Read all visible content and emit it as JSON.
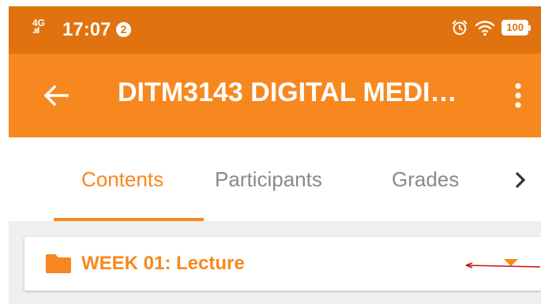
{
  "status_bar": {
    "network": "4G",
    "time": "17:07",
    "notification_count": "2",
    "battery": "100",
    "icons": [
      "signal-icon",
      "alarm-icon",
      "wifi-icon",
      "battery-icon"
    ]
  },
  "app_bar": {
    "title": "DITM3143 DIGITAL MEDI…",
    "back_icon": "arrow-left-icon",
    "menu_icon": "more-vertical-icon",
    "color": "#f7881f"
  },
  "tabs": {
    "items": [
      {
        "label": "Contents",
        "active": true
      },
      {
        "label": "Participants",
        "active": false
      },
      {
        "label": "Grades",
        "active": false
      }
    ],
    "next_icon": "chevron-right-icon"
  },
  "section": {
    "title": "WEEK 01: Lecture",
    "icon": "folder-icon",
    "toggle_icon": "caret-down-icon"
  },
  "colors": {
    "status_bar": "#e0730f",
    "accent": "#f7881f",
    "inactive_tab": "#8a8a8a",
    "annotation": "#d01010"
  }
}
